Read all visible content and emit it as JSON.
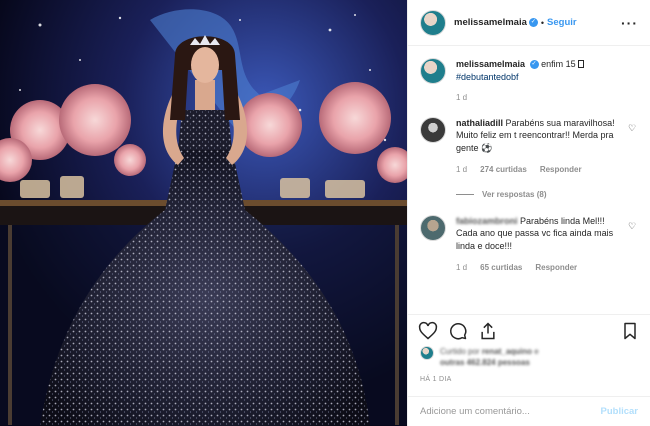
{
  "post": {
    "username": "melissamelmaia",
    "follow_label": "Seguir",
    "caption": "enfim 15",
    "caption_icon": "square-glyph",
    "hashtag": "#debutantedobf",
    "caption_age": "1 d"
  },
  "comments": [
    {
      "username": "nathaliadill",
      "text": "Parabéns sua maravilhosa! Muito feliz em t reencontrar!! Merda pra gente",
      "emoji": "⚽",
      "age": "1 d",
      "likes": "274 curtidas",
      "reply_label": "Responder",
      "view_replies": "Ver respostas (8)"
    },
    {
      "username": "fabiozambroni",
      "text": "Parabéns linda Mel!!! Cada ano que passa vc fica ainda mais linda e doce!!!",
      "age": "1 d",
      "likes": "65 curtidas",
      "reply_label": "Responder"
    }
  ],
  "likes_summary": {
    "prefix": "Curtido por",
    "user": "renat_aquino",
    "middle": "e",
    "others": "outras 462.824 pessoas"
  },
  "timestamp": "HÁ 1 DIA",
  "add_comment": {
    "placeholder": "Adicione um comentário...",
    "publish_label": "Publicar"
  },
  "colors": {
    "accent": "#3897f0",
    "publish_disabled": "#b2dffc",
    "secondary_text": "#8e8e8e"
  }
}
